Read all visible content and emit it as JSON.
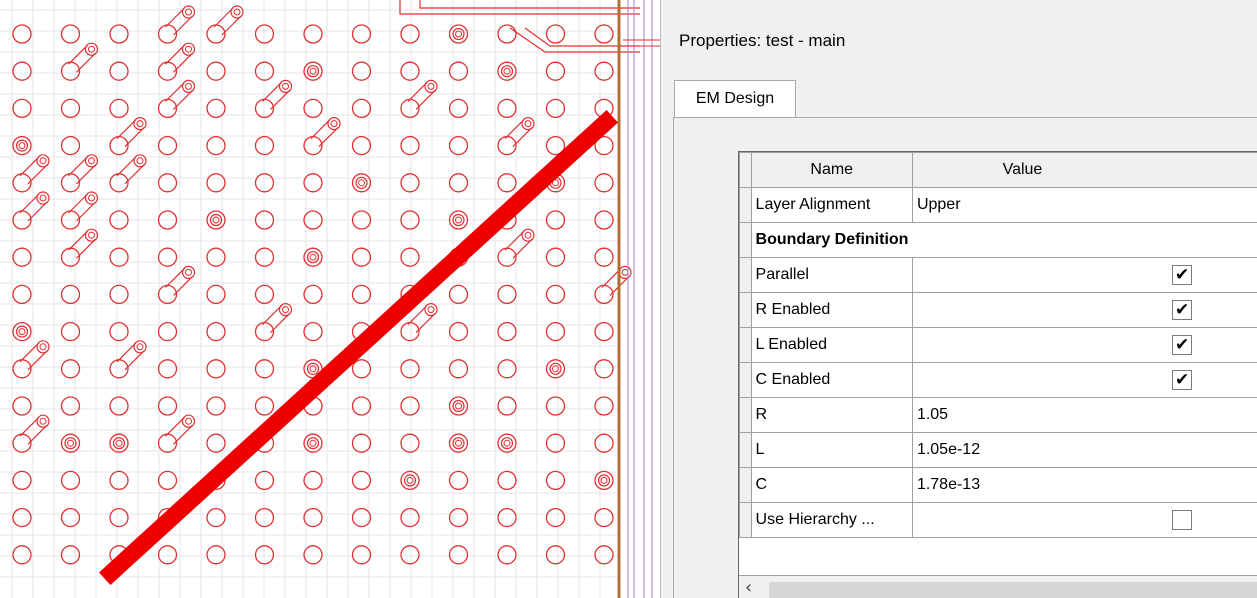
{
  "properties_panel": {
    "title": "Properties: test - main",
    "tabs": [
      {
        "label": "EM Design"
      }
    ],
    "columns": {
      "name": "Name",
      "value": "Value"
    },
    "rows": [
      {
        "name": "Layer Alignment",
        "value": "Upper",
        "type": "text"
      },
      {
        "name": "Boundary Definition",
        "value": "",
        "type": "group"
      },
      {
        "name": "Parallel",
        "value": "",
        "type": "checkbox",
        "checked": true
      },
      {
        "name": "R Enabled",
        "value": "",
        "type": "checkbox",
        "checked": true
      },
      {
        "name": "L Enabled",
        "value": "",
        "type": "checkbox",
        "checked": true
      },
      {
        "name": "C Enabled",
        "value": "",
        "type": "checkbox",
        "checked": true
      },
      {
        "name": "R",
        "value": "1.05",
        "type": "text"
      },
      {
        "name": "L",
        "value": "1.05e-12",
        "type": "text"
      },
      {
        "name": "C",
        "value": "1.78e-13",
        "type": "text"
      },
      {
        "name": "Use Hierarchy ...",
        "value": "",
        "type": "checkbox",
        "checked": false
      }
    ],
    "scroll_left_icon": "‹"
  },
  "layout_view": {
    "pad_color": "#e03030",
    "trace_color": "#ee0000",
    "board_edge_color": "#b07030",
    "icons": [
      "pad-icon",
      "via-icon",
      "trace"
    ]
  }
}
